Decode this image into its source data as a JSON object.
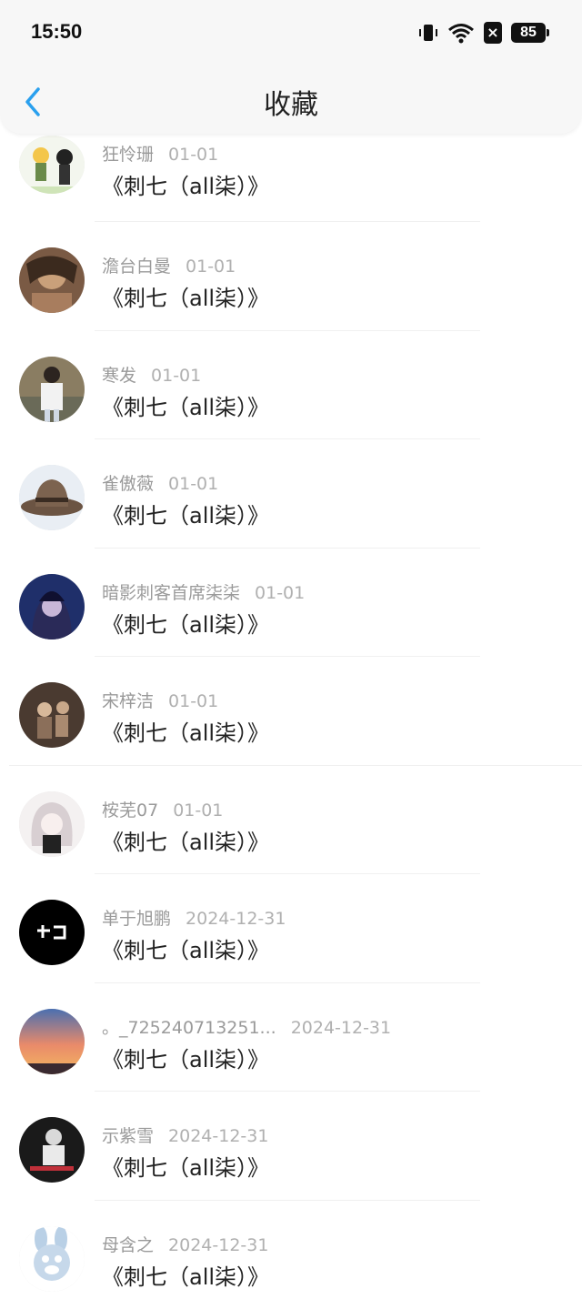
{
  "status": {
    "time": "15:50",
    "battery": "85"
  },
  "nav": {
    "title": "收藏"
  },
  "items": [
    {
      "user": "狂怜珊",
      "date": "01-01",
      "title": "《刺七（all柒）》"
    },
    {
      "user": "澹台白曼",
      "date": "01-01",
      "title": "《刺七（all柒）》"
    },
    {
      "user": "寒发",
      "date": "01-01",
      "title": "《刺七（all柒）》"
    },
    {
      "user": "雀傲薇",
      "date": "01-01",
      "title": "《刺七（all柒）》"
    },
    {
      "user": "暗影刺客首席柒柒",
      "date": "01-01",
      "title": "《刺七（all柒）》"
    },
    {
      "user": "宋梓洁",
      "date": "01-01",
      "title": "《刺七（all柒）》"
    },
    {
      "user": "桉芜07",
      "date": "01-01",
      "title": "《刺七（all柒）》"
    },
    {
      "user": "单于旭鹏",
      "date": "2024-12-31",
      "title": "《刺七（all柒）》"
    },
    {
      "user": "。_725240713251...",
      "date": "2024-12-31",
      "title": "《刺七（all柒）》"
    },
    {
      "user": "示紫雪",
      "date": "2024-12-31",
      "title": "《刺七（all柒）》"
    },
    {
      "user": "母含之",
      "date": "2024-12-31",
      "title": "《刺七（all柒）》"
    }
  ]
}
